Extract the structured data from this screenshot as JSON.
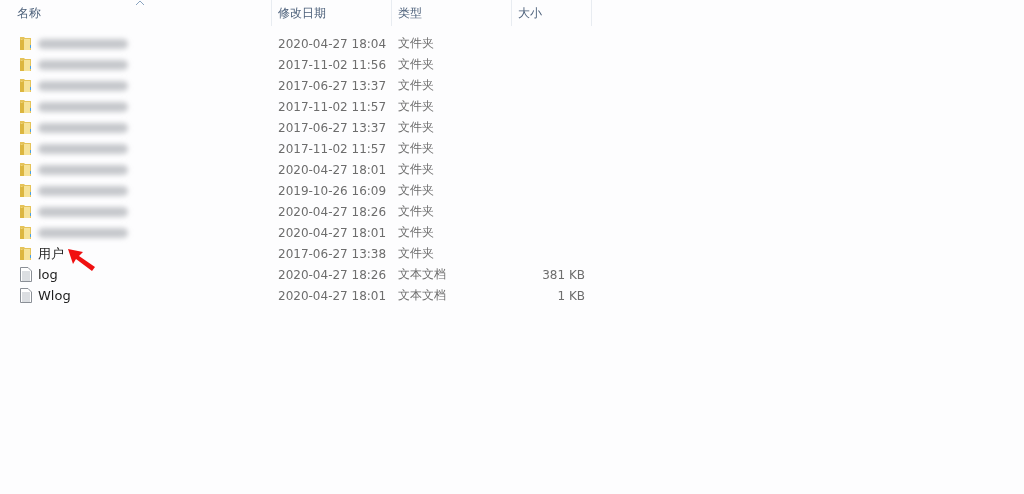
{
  "columns": [
    {
      "label": "名称",
      "sorted": true
    },
    {
      "label": "修改日期",
      "sorted": false
    },
    {
      "label": "类型",
      "sorted": false
    },
    {
      "label": "大小",
      "sorted": false
    }
  ],
  "rows": [
    {
      "kind": "folder",
      "redacted": true,
      "modified": "2020-04-27 18:04",
      "type": "文件夹"
    },
    {
      "kind": "folder",
      "redacted": true,
      "modified": "2017-11-02 11:56",
      "type": "文件夹"
    },
    {
      "kind": "folder",
      "redacted": true,
      "modified": "2017-06-27 13:37",
      "type": "文件夹"
    },
    {
      "kind": "folder",
      "redacted": true,
      "modified": "2017-11-02 11:57",
      "type": "文件夹"
    },
    {
      "kind": "folder",
      "redacted": true,
      "modified": "2017-06-27 13:37",
      "type": "文件夹"
    },
    {
      "kind": "folder",
      "redacted": true,
      "modified": "2017-11-02 11:57",
      "type": "文件夹"
    },
    {
      "kind": "folder",
      "redacted": true,
      "modified": "2020-04-27 18:01",
      "type": "文件夹"
    },
    {
      "kind": "folder",
      "redacted": true,
      "modified": "2019-10-26 16:09",
      "type": "文件夹"
    },
    {
      "kind": "folder",
      "redacted": true,
      "modified": "2020-04-27 18:26",
      "type": "文件夹"
    },
    {
      "kind": "folder",
      "redacted": true,
      "modified": "2020-04-27 18:01",
      "type": "文件夹"
    },
    {
      "kind": "folder",
      "name": "用户",
      "modified": "2017-06-27 13:38",
      "type": "文件夹",
      "pointer_arrow": true
    },
    {
      "kind": "text",
      "name": "log",
      "modified": "2020-04-27 18:26",
      "type": "文本文档",
      "size": "381 KB"
    },
    {
      "kind": "text",
      "name": "Wlog",
      "modified": "2020-04-27 18:01",
      "type": "文本文档",
      "size": "1 KB"
    }
  ]
}
